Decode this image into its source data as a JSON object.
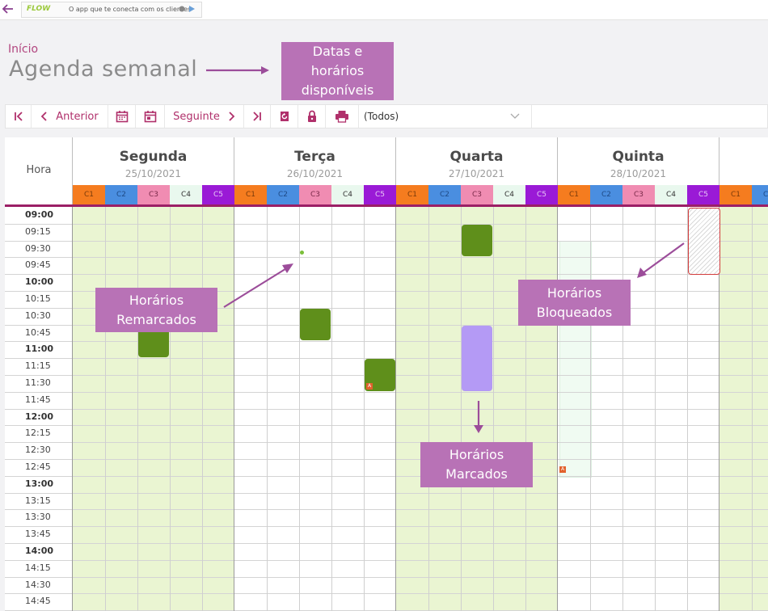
{
  "topbar": {
    "back_icon": "arrow-left-icon",
    "promo_logo": "FLOW",
    "promo_text": "O app que te conecta com os clientes",
    "promo_store_icons": " "
  },
  "breadcrumb": "Início",
  "page_title": "Agenda semanal",
  "annotations": {
    "datas": "Datas e\nhorários\ndisponíveis",
    "remarcados": "Horários\nRemarcados",
    "bloqueados": "Horários\nBloqueados",
    "marcados": "Horários\nMarcados"
  },
  "toolbar": {
    "first_icon": "first-page-icon",
    "prev_label": "Anterior",
    "calendar_icon": "calendar-icon",
    "calendar_day_icon": "calendar-day-icon",
    "next_label": "Seguinte",
    "last_icon": "last-page-icon",
    "refresh_icon": "refresh-icon",
    "lock_icon": "lock-icon",
    "print_icon": "print-icon",
    "filter_value": "(Todos)"
  },
  "calendar": {
    "hour_header": "Hora",
    "days": [
      {
        "name": "Segunda",
        "date": "25/10/2021"
      },
      {
        "name": "Terça",
        "date": "26/10/2021"
      },
      {
        "name": "Quarta",
        "date": "27/10/2021"
      },
      {
        "name": "Quinta",
        "date": "28/10/2021"
      },
      {
        "name": "",
        "date": ""
      }
    ],
    "columns": [
      {
        "label": "C1",
        "color": "#f57c1f",
        "text": "#7a3a0a"
      },
      {
        "label": "C2",
        "color": "#4a8ee0",
        "text": "#1e4a86"
      },
      {
        "label": "C3",
        "color": "#f08cb2",
        "text": "#7a2a4a"
      },
      {
        "label": "C4",
        "color": "#e9f8ee",
        "text": "#333333"
      },
      {
        "label": "C5",
        "color": "#9a1ad6",
        "text": "#e8c8f8"
      }
    ],
    "times": [
      "09:00",
      "09:15",
      "09:30",
      "09:45",
      "10:00",
      "10:15",
      "10:30",
      "10:45",
      "11:00",
      "11:15",
      "11:30",
      "11:45",
      "12:00",
      "12:15",
      "12:30",
      "12:45",
      "13:00",
      "13:15",
      "13:30",
      "13:45",
      "14:00",
      "14:15",
      "14:30",
      "14:45"
    ],
    "colors": {
      "available": "#eaf5d2",
      "appointment": "#5f8f1b",
      "rescheduled": "#b49af5",
      "light_block": "#f0fbf2",
      "accent": "#9b1f66"
    }
  }
}
